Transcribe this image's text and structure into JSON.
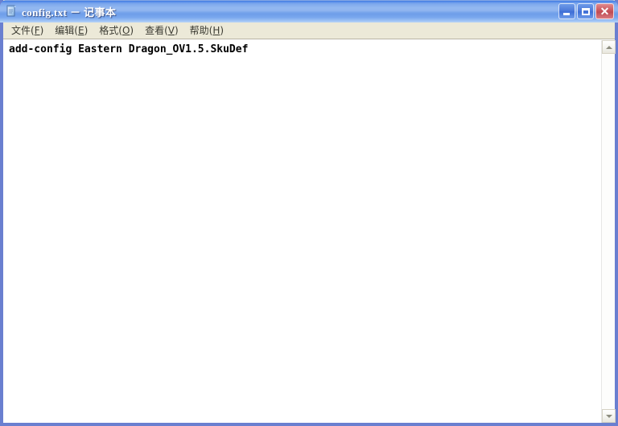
{
  "window": {
    "title": "config.txt － 记事本",
    "icon": "notepad-icon",
    "border_color": "#6a7fd0",
    "titlebar_color": "#8fb4ef"
  },
  "controls": {
    "minimize_label": "最小化",
    "maximize_label": "最大化",
    "close_label": "关闭",
    "close_glyph": "✕"
  },
  "menu": {
    "items": [
      {
        "name": "file",
        "prefix": "文件(",
        "mnemonic": "F",
        "suffix": ")"
      },
      {
        "name": "edit",
        "prefix": "编辑(",
        "mnemonic": "E",
        "suffix": ")"
      },
      {
        "name": "format",
        "prefix": "格式(",
        "mnemonic": "O",
        "suffix": ")"
      },
      {
        "name": "view",
        "prefix": "查看(",
        "mnemonic": "V",
        "suffix": ")"
      },
      {
        "name": "help",
        "prefix": "帮助(",
        "mnemonic": "H",
        "suffix": ")"
      }
    ]
  },
  "editor": {
    "lines": [
      "add-config Eastern Dragon_OV1.5.SkuDef"
    ],
    "text": "add-config Eastern Dragon_OV1.5.SkuDef",
    "font_color": "#000000",
    "background": "#ffffff"
  },
  "scrollbar": {
    "up_arrow": "▲",
    "down_arrow": "▼",
    "orientation": "vertical"
  }
}
